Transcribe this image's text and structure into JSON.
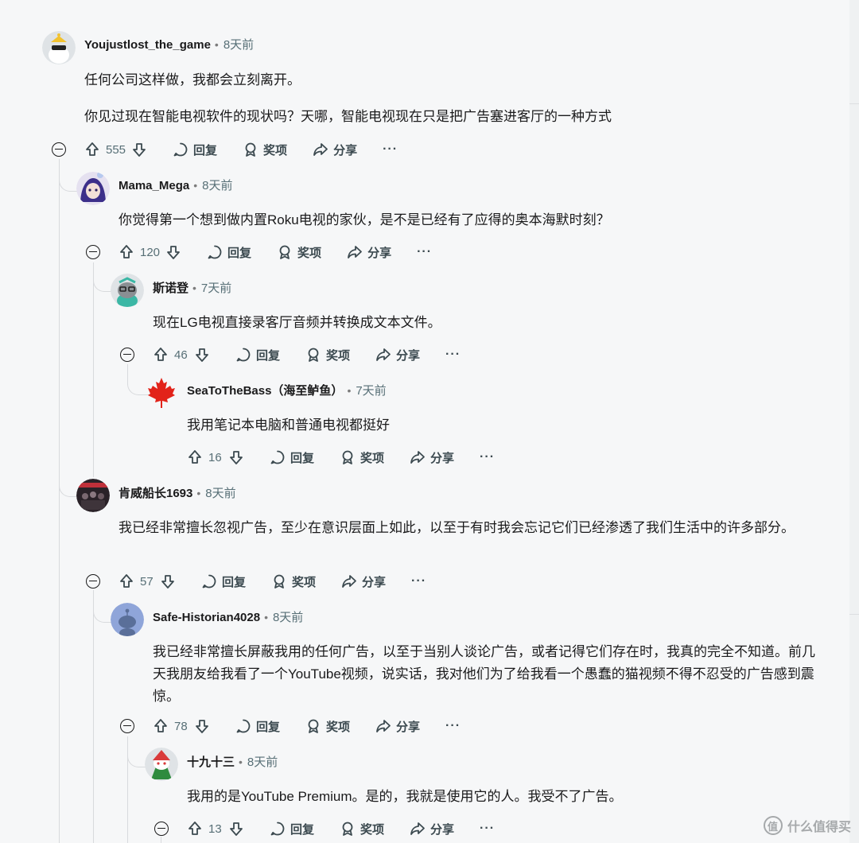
{
  "labels": {
    "reply": "回复",
    "award": "奖项",
    "share": "分享",
    "more": "···"
  },
  "comments": [
    {
      "author": "Youjustlost_the_game",
      "time": "8天前",
      "body": [
        "任何公司这样做，我都会立刻离开。",
        "你见过现在智能电视软件的现状吗？天哪，智能电视现在只是把广告塞进客厅的一种方式"
      ],
      "score": "555"
    },
    {
      "author": "Mama_Mega",
      "time": "8天前",
      "body": [
        "你觉得第一个想到做内置Roku电视的家伙，是不是已经有了应得的奥本海默时刻？"
      ],
      "score": "120"
    },
    {
      "author": "斯诺登",
      "time": "7天前",
      "body": [
        "现在LG电视直接录客厅音频并转换成文本文件。"
      ],
      "score": "46"
    },
    {
      "author": "SeaToTheBass（海至鲈鱼）",
      "time": "7天前",
      "body": [
        "我用笔记本电脑和普通电视都挺好"
      ],
      "score": "16"
    },
    {
      "author": "肯威船长1693",
      "time": "8天前",
      "body": [
        "我已经非常擅长忽视广告，至少在意识层面上如此，以至于有时我会忘记它们已经渗透了我们生活中的许多部分。"
      ],
      "score": "57"
    },
    {
      "author": "Safe-Historian4028",
      "time": "8天前",
      "body": [
        "我已经非常擅长屏蔽我用的任何广告，以至于当别人谈论广告，或者记得它们存在时，我真的完全不知道。前几天我朋友给我看了一个YouTube视频，说实话，我对他们为了给我看一个愚蠢的猫视频不得不忍受的广告感到震惊。"
      ],
      "score": "78"
    },
    {
      "author": "十九十三",
      "time": "8天前",
      "body": [
        "我用的是YouTube Premium。是的，我就是使用它的人。我受不了广告。"
      ],
      "score": "13"
    }
  ],
  "watermark": "什么值得买",
  "colors": {
    "background": "#f6f7f8",
    "text": "#1a1a1b",
    "meta": "#576f76",
    "thread_line": "#d8dadd"
  }
}
